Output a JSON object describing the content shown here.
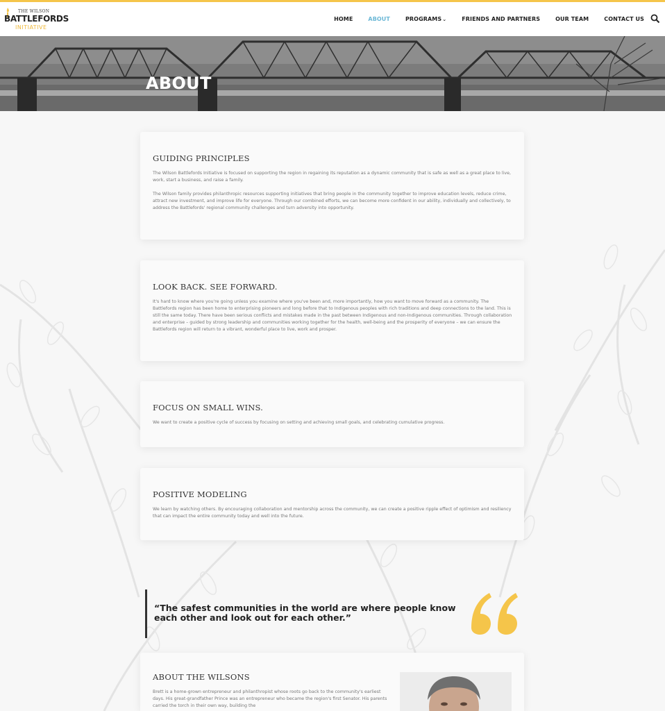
{
  "brand": {
    "logo_small": "THE WILSON",
    "logo_main": "BATTLEFORDS",
    "logo_sub": "INITIATIVE",
    "accent_color": "#f5c54a",
    "active_nav_color": "#6cb8d6"
  },
  "nav": {
    "items": [
      {
        "label": "HOME"
      },
      {
        "label": "ABOUT",
        "active": true
      },
      {
        "label": "PROGRAMS",
        "has_dropdown": true
      },
      {
        "label": "FRIENDS AND PARTNERS"
      },
      {
        "label": "OUR TEAM"
      },
      {
        "label": "CONTACT US"
      }
    ],
    "search_icon": "search-icon"
  },
  "hero": {
    "title": "ABOUT"
  },
  "sections": [
    {
      "title": "GUIDING PRINCIPLES",
      "paragraphs": [
        "The Wilson Battlefords Initiative is focused on supporting the region in regaining its reputation as a dynamic community that is safe as well as a great place to live, work, start a business, and raise a family.",
        "The Wilson family provides philanthropic resources supporting initiatives that bring people in the community together to improve education levels, reduce crime, attract new investment, and improve life for everyone. Through our combined efforts, we can become more confident in our ability, individually and collectively, to address the Battlefords' regional community challenges and turn adversity into opportunity."
      ]
    },
    {
      "title": "LOOK BACK. SEE FORWARD.",
      "paragraphs": [
        "It's hard to know where you're going unless you examine where you've been and, more importantly, how you want to move forward as a community. The Battlefords region has been home to enterprising pioneers and long before that to Indigenous peoples with rich traditions and deep connections to the land. This is still the same today. There have been serious conflicts and mistakes made in the past between Indigenous and non-Indigenous communities. Through collaboration and enterprise – guided by strong leadership and communities working together for the health, well-being and the prosperity of everyone – we can ensure the Battlefords region will return to a vibrant, wonderful place to live, work and prosper."
      ]
    },
    {
      "title": "FOCUS ON SMALL WINS.",
      "paragraphs": [
        "We want to create a positive cycle of success by focusing on setting and achieving small goals, and celebrating cumulative progress."
      ]
    },
    {
      "title": "POSITIVE MODELING",
      "paragraphs": [
        "We learn by watching others. By encouraging collaboration and mentorship across the community, we can create a positive ripple effect of optimism and resiliency that can impact the entire community today and well into the future."
      ]
    }
  ],
  "quote": {
    "text": "“The safest communities in the world are where people know each other and look out for each other.”",
    "mark_color": "#f5c54a"
  },
  "about_wilsons": {
    "title": "ABOUT THE WILSONS",
    "text": "Brett is a home-grown entrepreneur and philanthropist whose roots go back to the community's earliest days. His great-grandfather Prince was an entrepreneur who became the region's first Senator. His parents carried the torch in their own way, building the"
  }
}
